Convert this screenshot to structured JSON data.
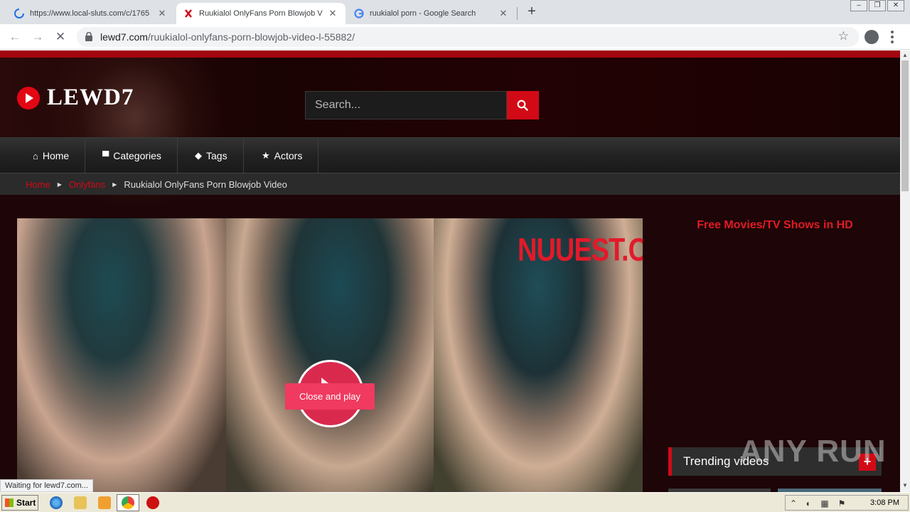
{
  "browser": {
    "tabs": [
      {
        "title": "https://www.local-sluts.com/c/1765",
        "state": "loading"
      },
      {
        "title": "Ruukialol OnlyFans Porn Blowjob Vide",
        "state": "active"
      },
      {
        "title": "ruukialol porn - Google Search",
        "state": "inactive"
      }
    ],
    "url_host": "lewd7.com",
    "url_path": "/ruukialol-onlyfans-porn-blowjob-video-l-55882/",
    "status_text": "Waiting for lewd7.com..."
  },
  "site": {
    "logo_text": "LEWD7",
    "search_placeholder": "Search...",
    "nav": [
      {
        "label": "Home",
        "icon": "home-icon"
      },
      {
        "label": "Categories",
        "icon": "folder-icon"
      },
      {
        "label": "Tags",
        "icon": "tags-icon"
      },
      {
        "label": "Actors",
        "icon": "star-icon"
      }
    ],
    "breadcrumb": {
      "home": "Home",
      "category": "Onlyfans",
      "current": "Ruukialol OnlyFans Porn Blowjob Video"
    },
    "player": {
      "watermark": "NUUEST.COM",
      "close_play_label": "Close and play"
    },
    "sidebar": {
      "ad_title": "Free Movies/TV Shows in HD",
      "trending_label": "Trending videos",
      "trending_plus": "+"
    }
  },
  "watermark_overlay": "ANY RUN",
  "taskbar": {
    "start_label": "Start",
    "clock": "3:08 PM"
  },
  "colors": {
    "accent_red": "#d10a16",
    "page_bg": "#1e0507",
    "button_pink": "#f03a5f"
  }
}
